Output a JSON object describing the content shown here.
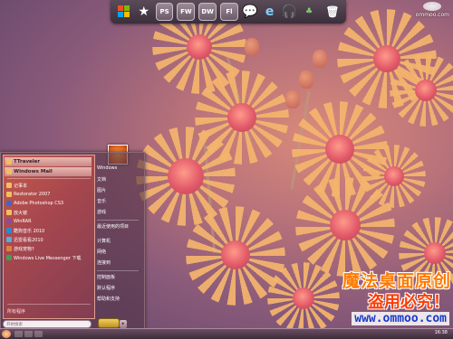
{
  "dock": {
    "items": [
      {
        "name": "windows-icon",
        "label": ""
      },
      {
        "name": "star-icon",
        "label": ""
      },
      {
        "name": "photoshop-icon",
        "label": "PS"
      },
      {
        "name": "fireworks-icon",
        "label": "FW"
      },
      {
        "name": "dreamweaver-icon",
        "label": "DW"
      },
      {
        "name": "flash-icon",
        "label": "Fl"
      },
      {
        "name": "chat-icon",
        "label": ""
      },
      {
        "name": "ie-icon",
        "label": ""
      },
      {
        "name": "headphones-icon",
        "label": ""
      },
      {
        "name": "recycle-icon",
        "label": ""
      }
    ]
  },
  "watermark_top": {
    "line1": "ommoo.com",
    "line2": ""
  },
  "start_menu": {
    "pinned": [
      {
        "label": "TTraveler",
        "bold": true
      },
      {
        "label": "Windows Mail",
        "bold": true
      }
    ],
    "recent": [
      {
        "label": "记事本"
      },
      {
        "label": "Restorator 2007"
      },
      {
        "label": "Adobe Photoshop CS3"
      },
      {
        "label": "放大镜"
      },
      {
        "label": "WinRAR"
      },
      {
        "label": "酷狗音乐 2010"
      },
      {
        "label": "迅雷看看2010"
      },
      {
        "label": "游戏宠物?"
      },
      {
        "label": "Windows Live Messenger 下载"
      }
    ],
    "all_programs": "所有程序",
    "search_placeholder": "开始搜索",
    "right_items": [
      "Windows",
      "文档",
      "图片",
      "音乐",
      "游戏",
      "最近使用的项目",
      "计算机",
      "网络",
      "连接到",
      "控制面板",
      "默认程序",
      "帮助和支持"
    ]
  },
  "taskbar": {
    "clock": "16:38"
  },
  "watermark": {
    "line1": "魔法桌面原创",
    "line2": "盗用必究！",
    "url": "www.ommoo.com"
  }
}
